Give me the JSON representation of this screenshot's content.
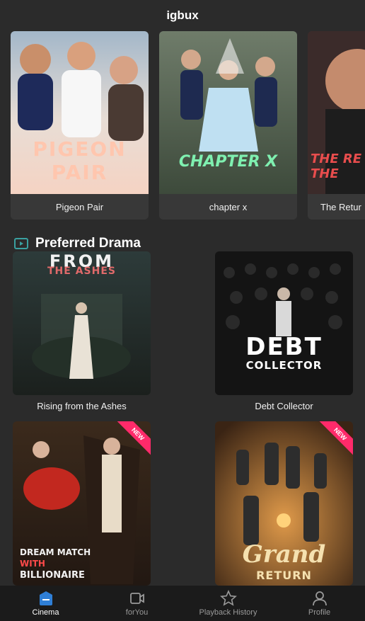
{
  "header": {
    "title": "igbux"
  },
  "carousel": {
    "items": [
      {
        "title": "Pigeon Pair",
        "poster_text": [
          "PIGEON",
          "PAIR"
        ]
      },
      {
        "title": "chapter x",
        "poster_text": "CHAPTER X"
      },
      {
        "title": "The Retur",
        "poster_text": [
          "THE RE",
          "THE"
        ]
      }
    ]
  },
  "section": {
    "title": "Preferred Drama",
    "icon": "play-square-icon"
  },
  "grid": {
    "items": [
      {
        "title": "Rising from the Ashes",
        "poster_text_top": "FROM",
        "poster_text_sub": "THE ASHES"
      },
      {
        "title": "Debt Collector",
        "poster_text_top": "DEBT",
        "poster_text_sub": "COLLECTOR"
      },
      {
        "title": "",
        "poster_text_top": "DREAM MATCH",
        "poster_text_mid": "WITH",
        "poster_text_sub": "BILLIONAIRE",
        "badge": "NEW"
      },
      {
        "title": "",
        "poster_text_top": "Grand",
        "poster_text_sub": "RETURN",
        "badge": "NEW"
      }
    ]
  },
  "nav": {
    "items": [
      {
        "label": "Cinema",
        "icon": "cinema-icon",
        "active": true
      },
      {
        "label": "forYou",
        "icon": "video-camera-icon",
        "active": false
      },
      {
        "label": "Playback History",
        "icon": "star-icon",
        "active": false
      },
      {
        "label": "Profile",
        "icon": "person-icon",
        "active": false
      }
    ]
  },
  "colors": {
    "accent": "#2f7fd6",
    "badge": "#ff2a6a",
    "background": "#2b2b2b",
    "nav_bg": "#1b1b1b"
  }
}
